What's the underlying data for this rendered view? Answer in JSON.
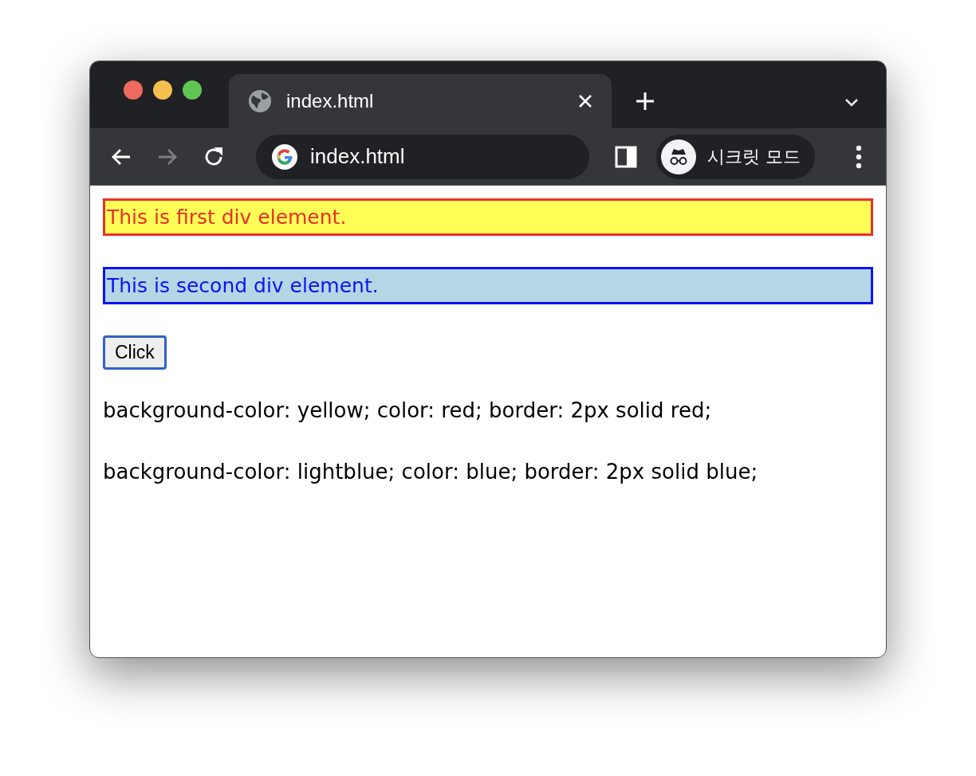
{
  "tabs": [
    {
      "label": "index.html",
      "selected": true
    }
  ],
  "toolbar": {
    "nav": [
      {
        "kind": "back",
        "disabled": false
      },
      {
        "kind": "forward",
        "disabled": true
      },
      {
        "kind": "reload",
        "disabled": false
      }
    ],
    "address": "index.html",
    "profile": "시크릿 모드"
  },
  "content": {
    "divs": [
      {
        "text": "This is first div element.",
        "color": "#e8302a",
        "background": {
          "color": "#ffff55"
        }
      },
      {
        "text": "This is second div element.",
        "color": "#0a13f5",
        "background": {
          "color": "#b5d6e4"
        }
      }
    ],
    "button": "Click",
    "lines": [
      "background-color: yellow; color: red; border: 2px solid red;",
      "background-color: lightblue; color: blue; border: 2px solid blue;"
    ]
  }
}
